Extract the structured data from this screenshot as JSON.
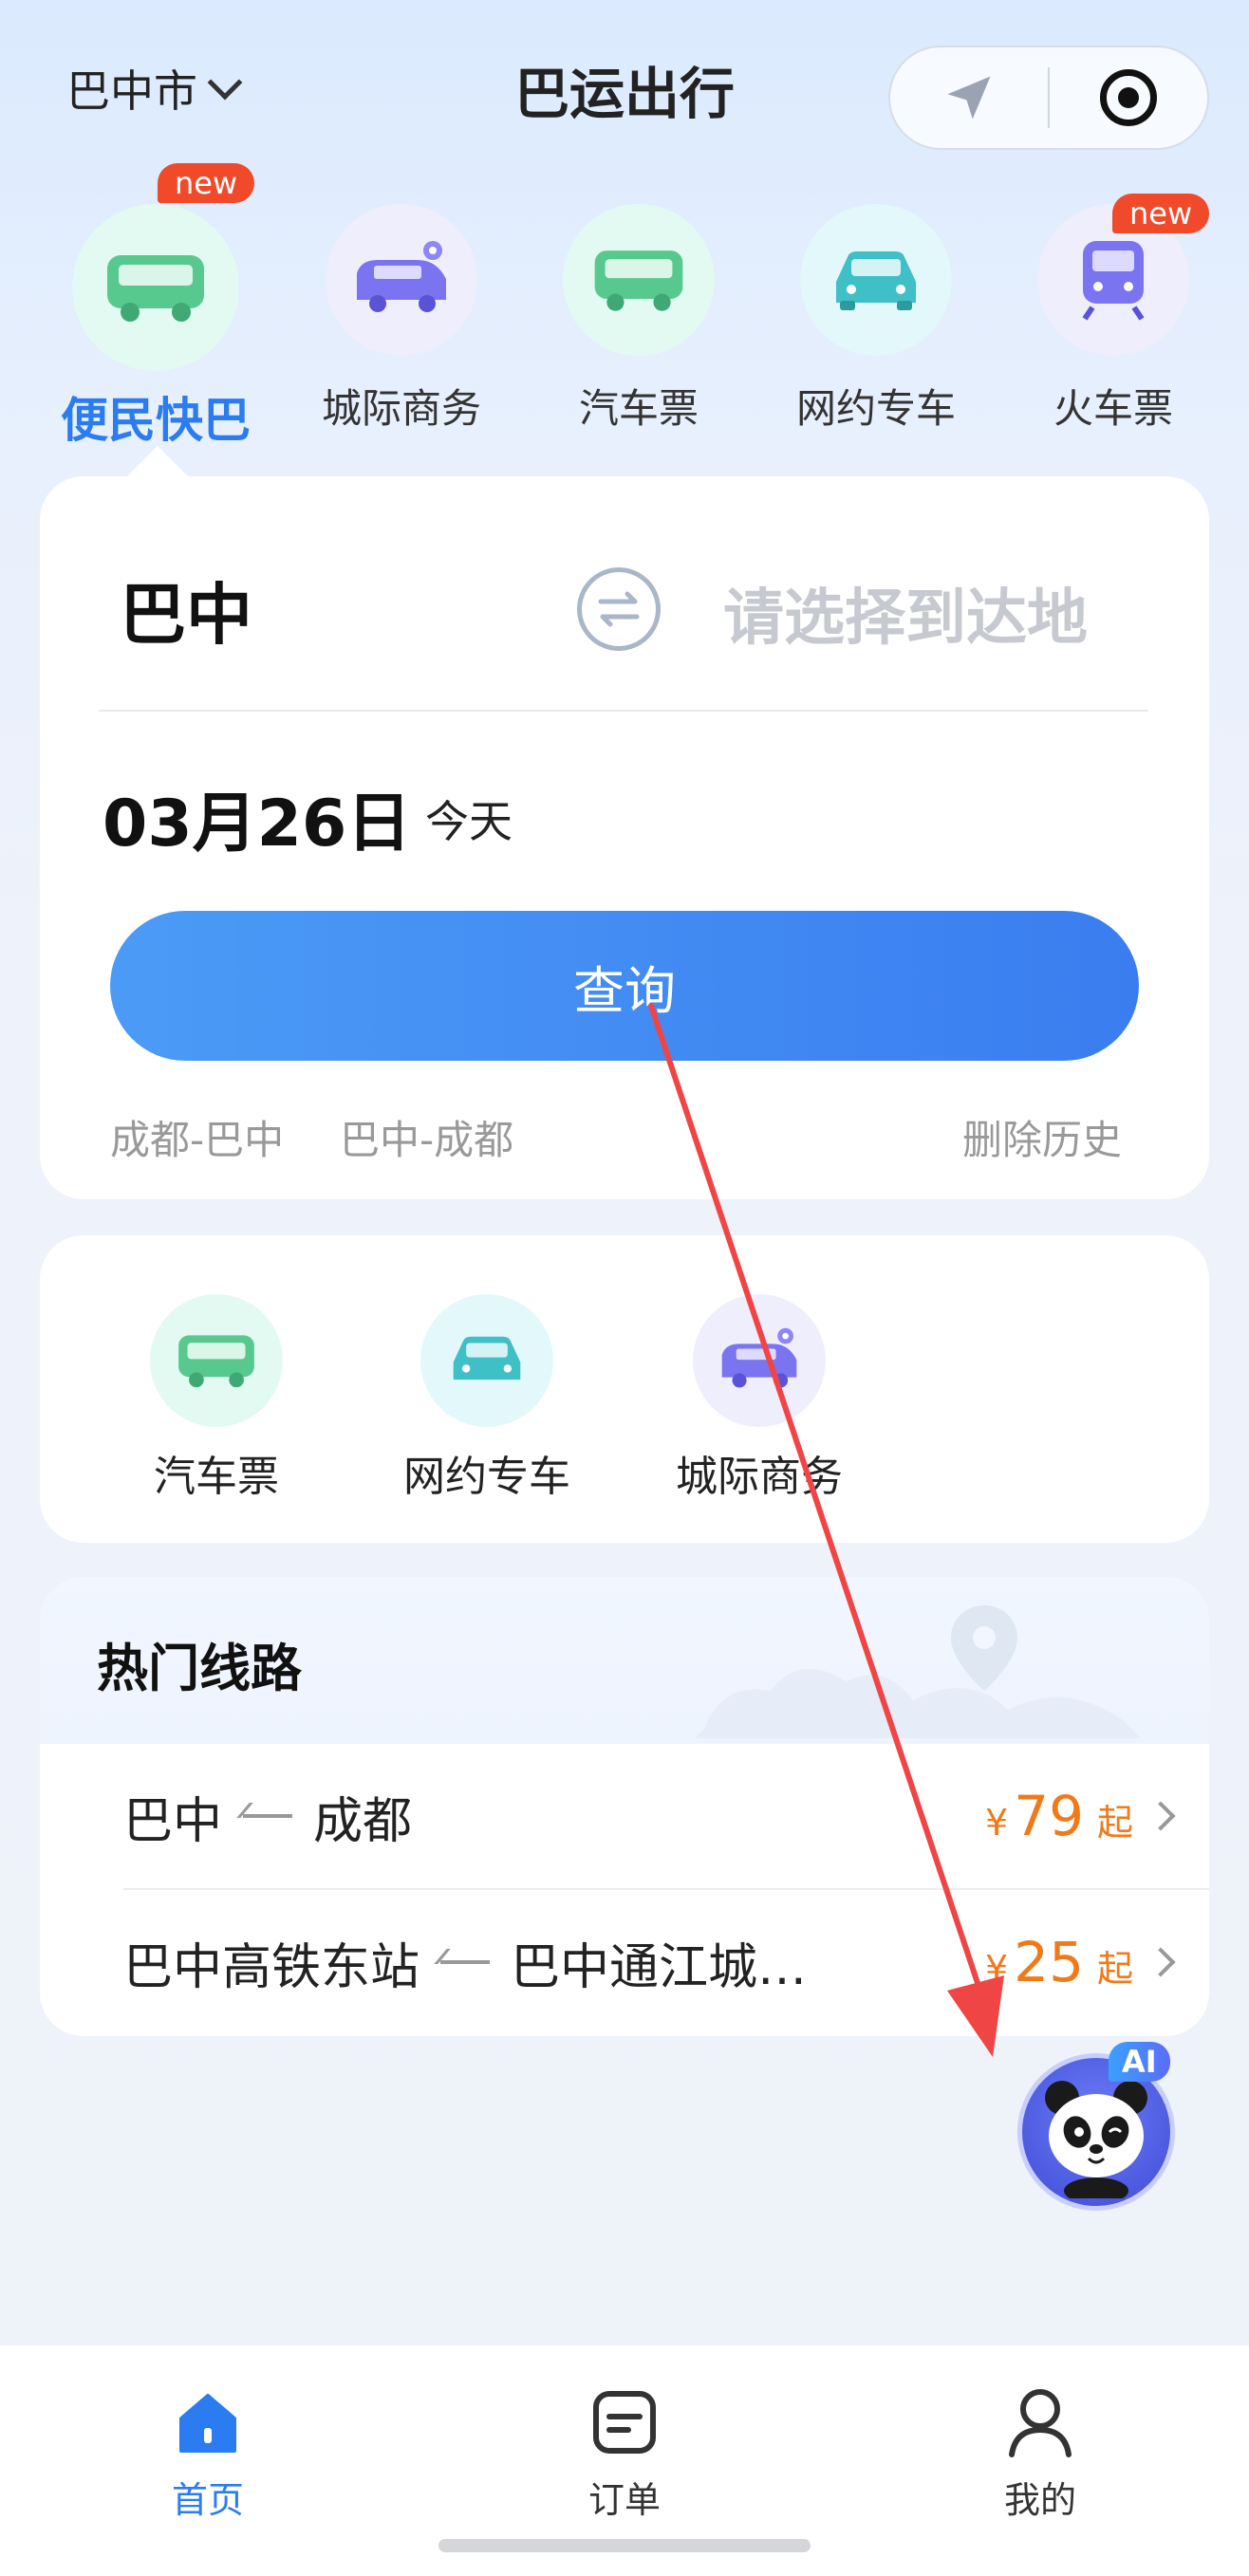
{
  "header": {
    "city": "巴中市",
    "title": "巴运出行"
  },
  "categories": [
    {
      "label": "便民快巴",
      "badge": "new",
      "icon": "minibus-icon",
      "active": true
    },
    {
      "label": "城际商务",
      "badge": "",
      "icon": "business-van-icon"
    },
    {
      "label": "汽车票",
      "badge": "",
      "icon": "bus-icon"
    },
    {
      "label": "网约专车",
      "badge": "",
      "icon": "car-icon"
    },
    {
      "label": "火车票",
      "badge": "new",
      "icon": "train-icon"
    }
  ],
  "search": {
    "from": "巴中",
    "to_placeholder": "请选择到达地",
    "date": "03月26日",
    "date_hint": "今天",
    "query_label": "查询",
    "history": [
      "成都-巴中",
      "巴中-成都"
    ],
    "clear_history": "删除历史"
  },
  "services": [
    {
      "label": "汽车票",
      "icon": "bus-icon"
    },
    {
      "label": "网约专车",
      "icon": "car-icon"
    },
    {
      "label": "城际商务",
      "icon": "business-van-icon"
    }
  ],
  "hot_routes": {
    "title": "热门线路",
    "routes": [
      {
        "from": "巴中",
        "to": "成都",
        "currency": "¥",
        "price": "79",
        "suffix": "起"
      },
      {
        "from": "巴中高铁东站",
        "to": "巴中通江城…",
        "currency": "¥",
        "price": "25",
        "suffix": "起"
      }
    ]
  },
  "ai_assistant": {
    "tag": "AI",
    "icon": "panda-icon"
  },
  "tabs": [
    {
      "label": "首页",
      "icon": "home-icon",
      "active": true
    },
    {
      "label": "订单",
      "icon": "order-icon"
    },
    {
      "label": "我的",
      "icon": "profile-icon"
    }
  ],
  "colors": {
    "accent": "#2a7cf0",
    "price": "#f07a1a",
    "badge": "#f04a2a",
    "annotation": "#f04545"
  }
}
